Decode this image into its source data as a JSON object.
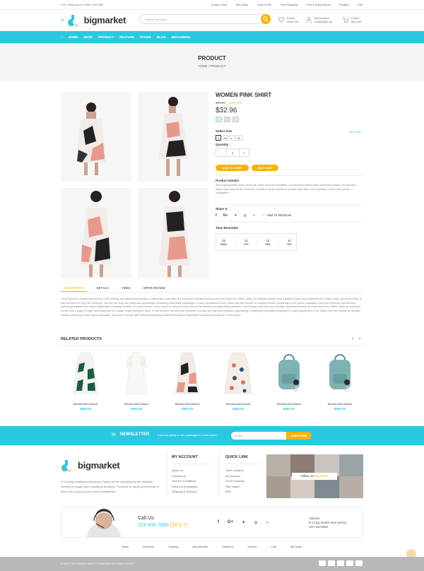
{
  "topbar": {
    "free_shipping": "Free Shipping On Order Over $99",
    "links": [
      "Today's Deal",
      "Gift Cards",
      "Track Order",
      "Free Shipping",
      "Free & Easy Return",
      "English",
      "USD"
    ]
  },
  "header": {
    "logo": "bigmarket",
    "search_placeholder": "Search a product",
    "wishlist": {
      "count": "0 Item",
      "label": "Wish List"
    },
    "account": {
      "line1": "My Account",
      "line2": "Login/Sign Up"
    },
    "cart": {
      "count": "0 Item",
      "label": "My Cart"
    }
  },
  "nav": {
    "items": [
      "HOME",
      "SHOP",
      "PRODUCT",
      "FEATURE",
      "PAGES",
      "BLOG",
      "MEGAMENU"
    ]
  },
  "banner": {
    "title": "PRODUCT",
    "breadcrumb": "HOME / PRODUCT"
  },
  "product": {
    "name": "WOMEN PINK SHIRT",
    "old_price": "$80.00",
    "discount": "15% OFF",
    "price": "$32.96",
    "select_size_label": "Select Size",
    "size_chart": "Size Chart",
    "sizes": [
      "S",
      "M",
      "L",
      "XL"
    ],
    "quantity_label": "Quantity",
    "quantity": "1",
    "minus": "-",
    "plus": "+",
    "add_to_cart": "ADD TO CART",
    "buy_now": "BUY NOW",
    "details_label": "Product Details",
    "details_text": "Sed ut perspiciatis unde omnis iste natus error sit voluptatem accusantium doloremque laudantium totam rem aperiam eaque ipsa quae ab illo inventore veritatis et quasi architecto beatae vitae dicta sunt explicabo. Nemo enim ipsam voluptatem.",
    "share_label": "Share It",
    "wishlist_label": "Add To WishList",
    "time_label": "Time Reminder",
    "timer": [
      {
        "value": "25",
        "unit": "Days"
      },
      {
        "value": "22",
        "unit": "Hrs"
      },
      {
        "value": "13",
        "unit": "Min"
      },
      {
        "value": "57",
        "unit": "Sec"
      }
    ],
    "swatch_colors": [
      "#cfeef6",
      "#e8d9d9",
      "#e6e6e6"
    ]
  },
  "tabs": [
    "DESCRIPTION",
    "DETAILS",
    "VIDEO",
    "WRITE REVIEW"
  ],
  "description": "Lorem Ipsum is simply dummy text of the printing and typesetting industry. Lorem Ipsum has been the industry's standard dummy text ever since the 1500s, when an unknown printer took a galley of type and scrambled it to make a type specimen book. It has survived not only five centuries, but also the leap into electronic typesetting, remaining essentially unchanged. It was popularised in the 1960s with the release of Letraset sheets containing Lorem Ipsum passages, and more recently with desktop publishing software like Aldus PageMaker including versions of Lorem Ipsum. Lorem Ipsum is simply dummy text of the printing and typesetting industry. Lorem Ipsum has been the industry's standard dummy text ever since the 1500s, when an unknown printer took a galley of type and scrambled it to make a type specimen book. It has survived not only five centuries, but also the leap into electronic typesetting, remaining essentially unchanged. It was popularised in the 1960s with the release of Letraset sheets containing Lorem Ipsum passages, and more recently with desktop publishing software like Aldus PageMaker including versions of Lorem Ipsum.",
  "related": {
    "title": "RELATED PRODUCTS",
    "items": [
      {
        "name": "Richard McClintock",
        "price": "$963.00"
      },
      {
        "name": "Richard McClintock",
        "price": "$963.00"
      },
      {
        "name": "Richard McClintock",
        "price": "$963.00"
      },
      {
        "name": "Richard McClintock",
        "price": "$963.00"
      },
      {
        "name": "Richard McClintock",
        "price": "$963.00"
      },
      {
        "name": "Richard McClintock",
        "price": "$963.00"
      }
    ]
  },
  "newsletter": {
    "title": "NEWSLETTER",
    "text": "If you are going to use a passage of Lorem Ipsum.",
    "placeholder": "Email...",
    "button": "SUBSCRIBE"
  },
  "footer": {
    "logo": "bigmarket",
    "about": "It is a long established fact that a reader will be distracted by the readable content of a page when looking at its layout. The point of using Lorem Ipsum is that it has a more-or-less normal distribution",
    "my_account": {
      "title": "MY ACCOUNT",
      "links": [
        "About Us",
        "Contact Us",
        "Terms & Conditions",
        "Return & Exchanges",
        "Shipping & Delivery"
      ]
    },
    "quick_link": {
      "title": "QUICK LINK",
      "links": [
        "Store Location",
        "My Account",
        "Order Tracking",
        "Size Guide",
        "FAQ"
      ]
    },
    "follow": "Follow Us",
    "follow_brand": "Big Market",
    "call_label": "Call Us:",
    "phone": "123-456-7890",
    "phone_note": "(24 X 7)",
    "address_label": "Address",
    "address_line1": "B-14 big market near School",
    "address_line2": "USA 653-8964.",
    "bottom_links": [
      "Mens",
      "Womens",
      "Clothing",
      "Accessories",
      "Featured",
      "Service",
      "Cart",
      "My Order"
    ],
    "copyright": "© 2017 SETHEMEFOREST POWERED BY PIXELSTRAP"
  },
  "colors": {
    "accent": "#2bc8e2",
    "highlight": "#f8b20e",
    "footer_bar": "#b8b8b8"
  }
}
